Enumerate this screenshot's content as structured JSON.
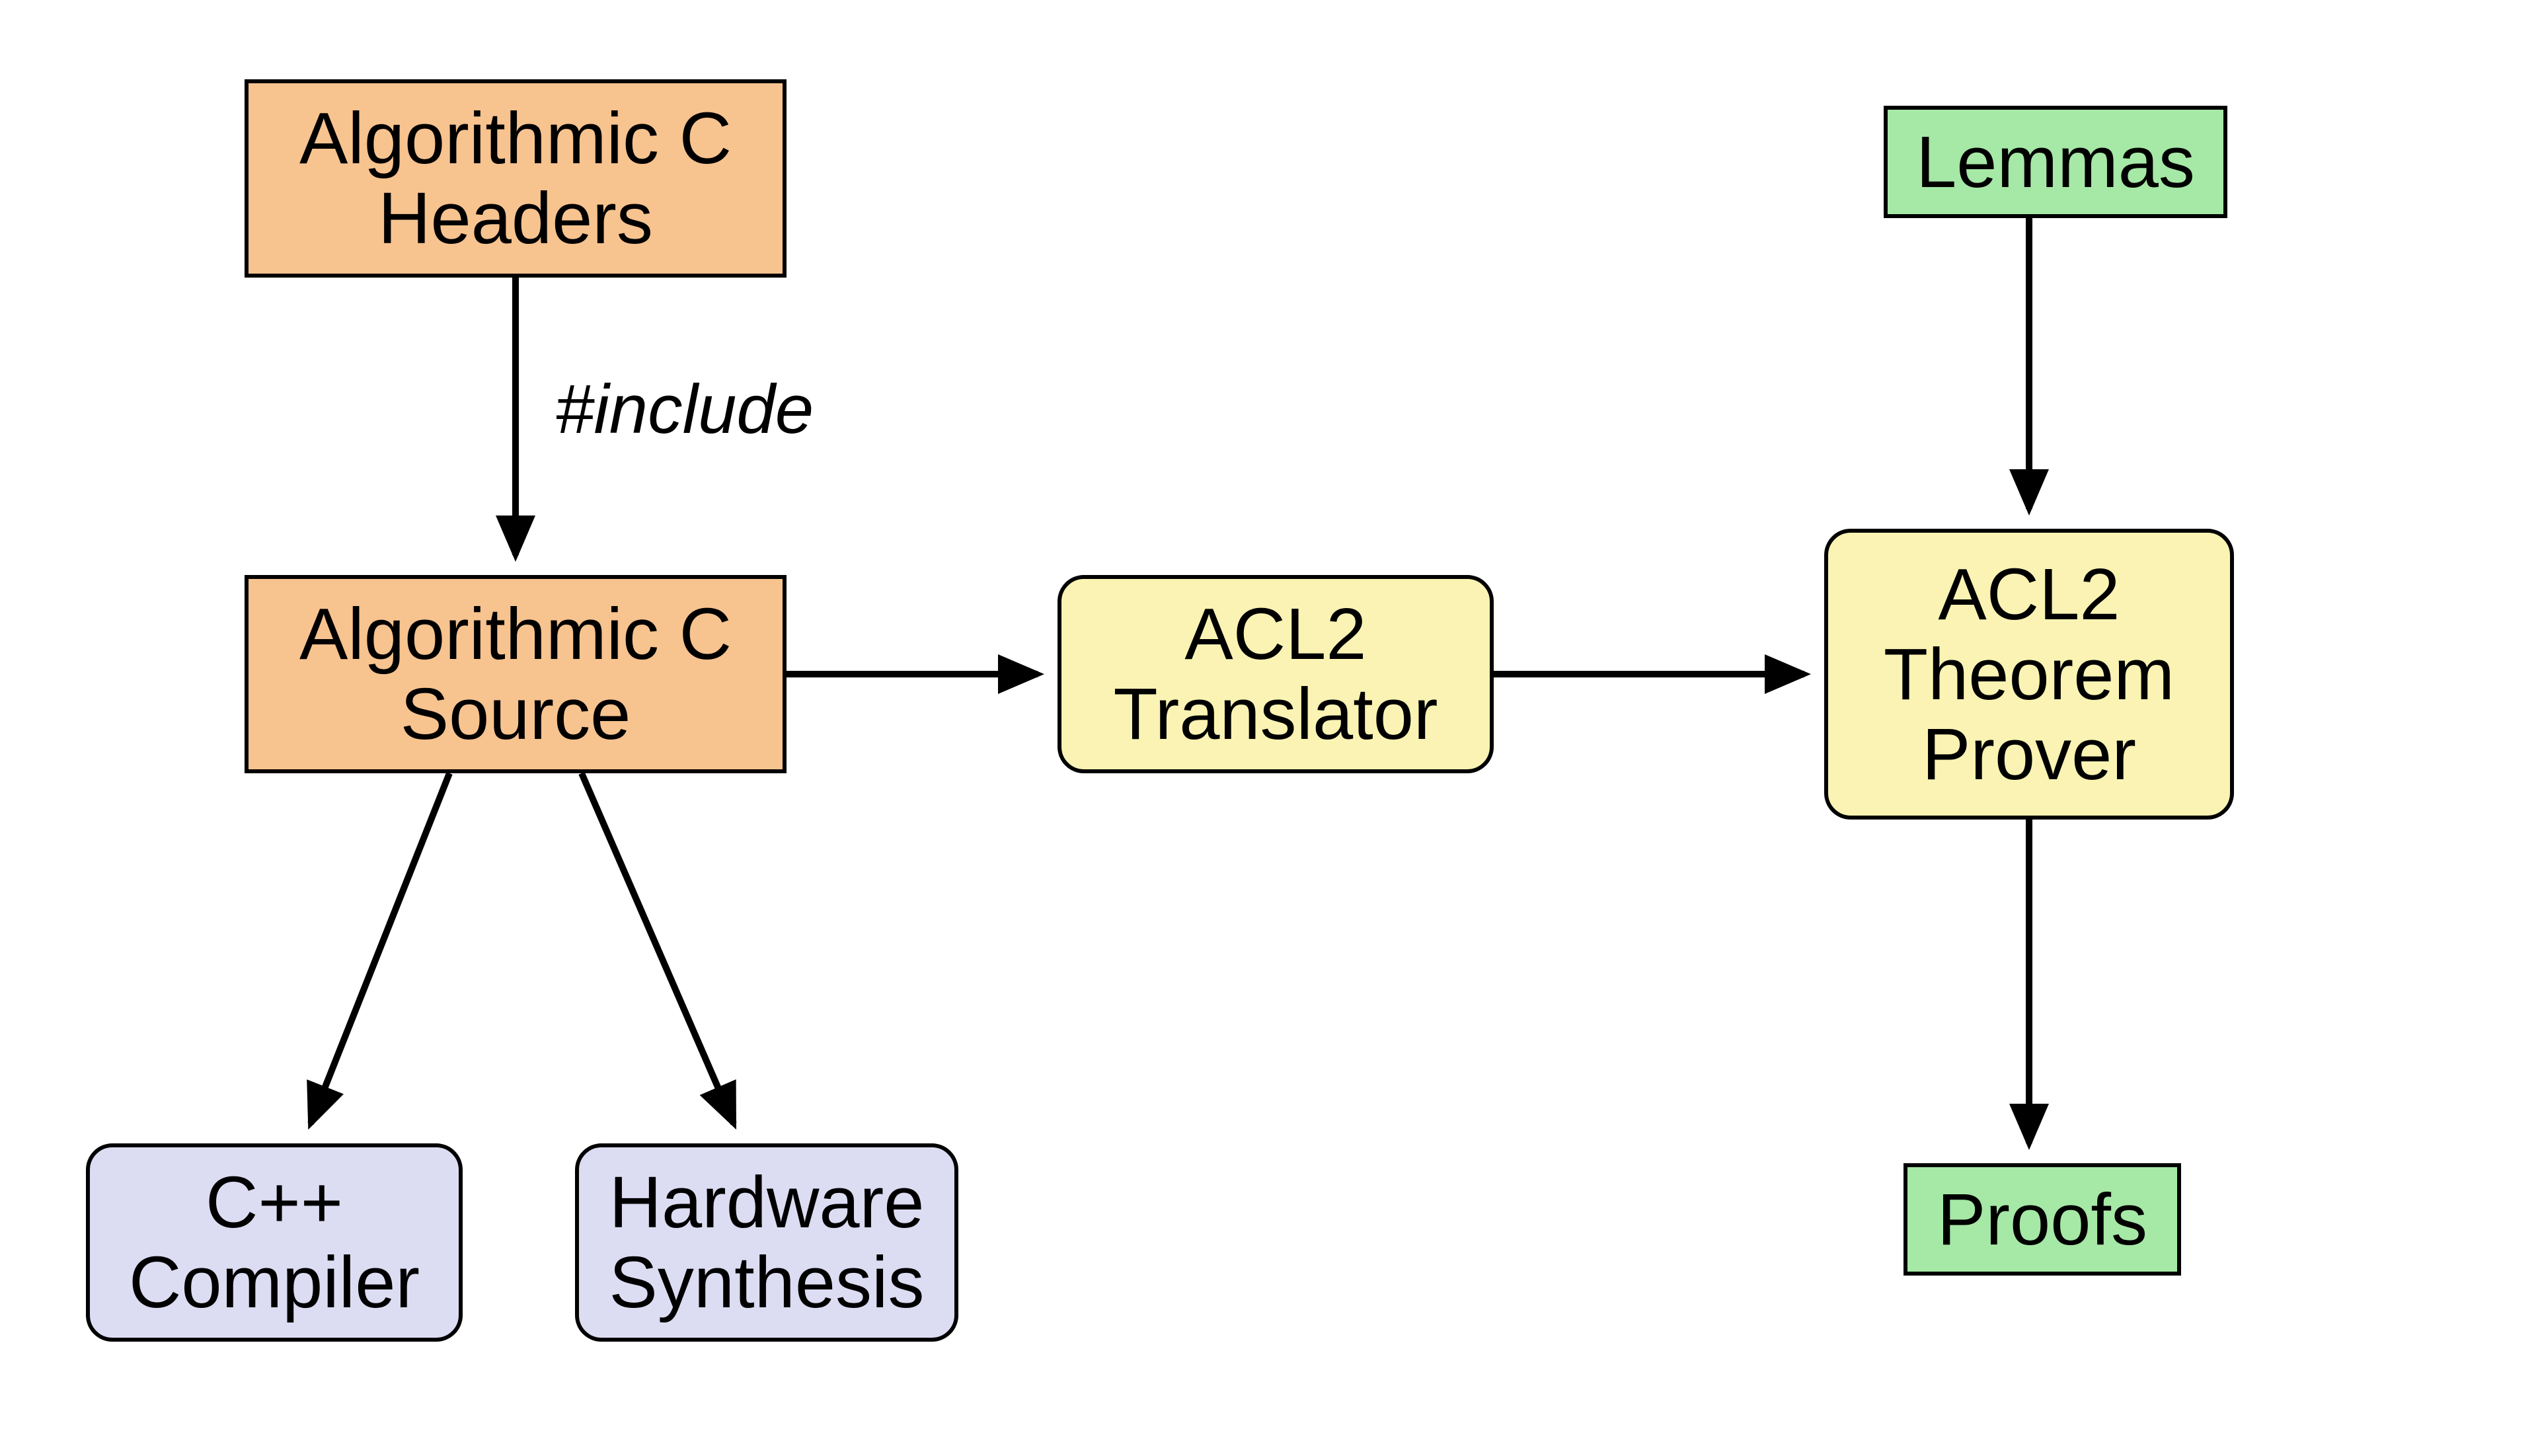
{
  "nodes": {
    "algc_headers": "Algorithmic C\nHeaders",
    "algc_source": "Algorithmic C\nSource",
    "acl2_translator": "ACL2\nTranslator",
    "acl2_prover": "ACL2\nTheorem\nProver",
    "lemmas": "Lemmas",
    "proofs": "Proofs",
    "cpp_compiler": "C++\nCompiler",
    "hw_synthesis": "Hardware\nSynthesis"
  },
  "edge_labels": {
    "include": "#include"
  },
  "colors": {
    "orange": "#f7c38f",
    "yellow": "#faf3b3",
    "blue": "#dcdcf2",
    "green": "#a6e8a6",
    "stroke": "#000000"
  },
  "edges": [
    {
      "from": "algc_headers",
      "to": "algc_source",
      "label": "include"
    },
    {
      "from": "algc_source",
      "to": "acl2_translator",
      "label": null
    },
    {
      "from": "acl2_translator",
      "to": "acl2_prover",
      "label": null
    },
    {
      "from": "lemmas",
      "to": "acl2_prover",
      "label": null
    },
    {
      "from": "acl2_prover",
      "to": "proofs",
      "label": null
    },
    {
      "from": "algc_source",
      "to": "cpp_compiler",
      "label": null
    },
    {
      "from": "algc_source",
      "to": "hw_synthesis",
      "label": null
    }
  ]
}
